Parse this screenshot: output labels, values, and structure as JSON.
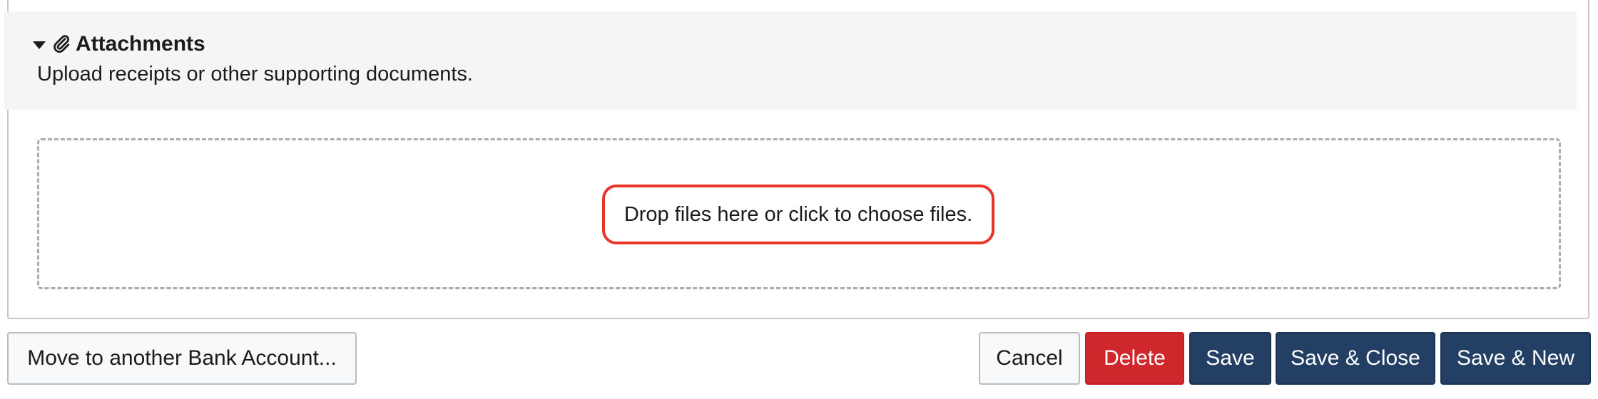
{
  "attachments": {
    "title": "Attachments",
    "description": "Upload receipts or other supporting documents.",
    "dropzone_text": "Drop files here or click to choose files."
  },
  "actions": {
    "move_label": "Move to another Bank Account...",
    "cancel_label": "Cancel",
    "delete_label": "Delete",
    "save_label": "Save",
    "save_close_label": "Save & Close",
    "save_new_label": "Save & New"
  },
  "colors": {
    "primary": "#233f63",
    "danger": "#d0272c",
    "highlight": "#e8352a",
    "panel_header_bg": "#f5f5f5"
  },
  "icons": {
    "section_toggle": "caret-down-icon",
    "section": "paperclip-icon"
  }
}
